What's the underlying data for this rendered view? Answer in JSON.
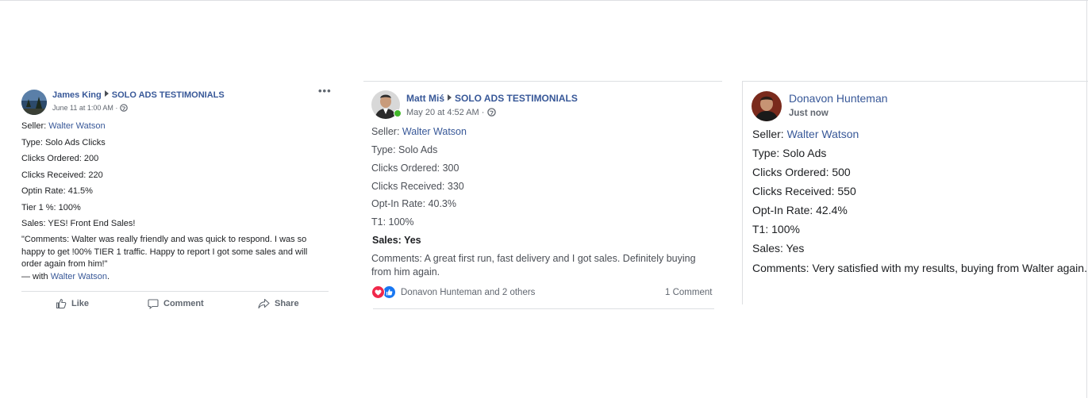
{
  "posts": [
    {
      "author": "James King",
      "group": "SOLO ADS TESTIMONIALS",
      "timestamp": "June 11 at 1:00 AM",
      "menu_icon": "ellipsis-icon",
      "lines": {
        "seller_label": "Seller: ",
        "seller_name": "Walter Watson",
        "type": "Type: Solo Ads Clicks",
        "ordered": "Clicks Ordered: 200",
        "received": "Clicks Received: 220",
        "optin": "Optin Rate: 41.5%",
        "tier": "Tier 1 %: 100%",
        "sales": "Sales: YES! Front End Sales!",
        "comment_1": "\"Comments: Walter was really friendly and was quick to respond. I was so",
        "comment_2": "happy to get !00% TIER 1 traffic. Happy to report I got some sales and will",
        "comment_3": "order again from him!\"",
        "with_prefix": "— with ",
        "with_name": "Walter Watson",
        "with_suffix": "."
      },
      "actions": {
        "like": "Like",
        "comment": "Comment",
        "share": "Share"
      }
    },
    {
      "author": "Matt Miś",
      "group": "SOLO ADS TESTIMONIALS",
      "timestamp": "May 20 at 4:52 AM",
      "lines": {
        "seller_label": "Seller: ",
        "seller_name": "Walter Watson",
        "type": "Type: Solo Ads",
        "ordered": "Clicks Ordered: 300",
        "received": "Clicks Received: 330",
        "optin": "Opt-In Rate: 40.3%",
        "t1": "T1: 100%",
        "sales": "Sales: Yes",
        "comment_1": "Comments:  A great first run, fast delivery and I got sales. Definitely buying",
        "comment_2": "from him again."
      },
      "reactions_text": "Donavon Hunteman and 2 others",
      "comments_count": "1 Comment"
    },
    {
      "author": "Donavon Hunteman",
      "timestamp": "Just now",
      "lines": {
        "seller_label": "Seller: ",
        "seller_name": "Walter Watson",
        "type": "Type: Solo Ads",
        "ordered": "Clicks Ordered: 500",
        "received": "Clicks Received: 550",
        "optin": "Opt-In Rate: 42.4%",
        "t1": "T1: 100%",
        "sales": "Sales: Yes",
        "comment": "Comments: Very satisfied with my results, buying from Walter again."
      }
    }
  ],
  "colors": {
    "link": "#385898",
    "text": "#1c1e21",
    "muted": "#616770",
    "online": "#42b72a"
  }
}
